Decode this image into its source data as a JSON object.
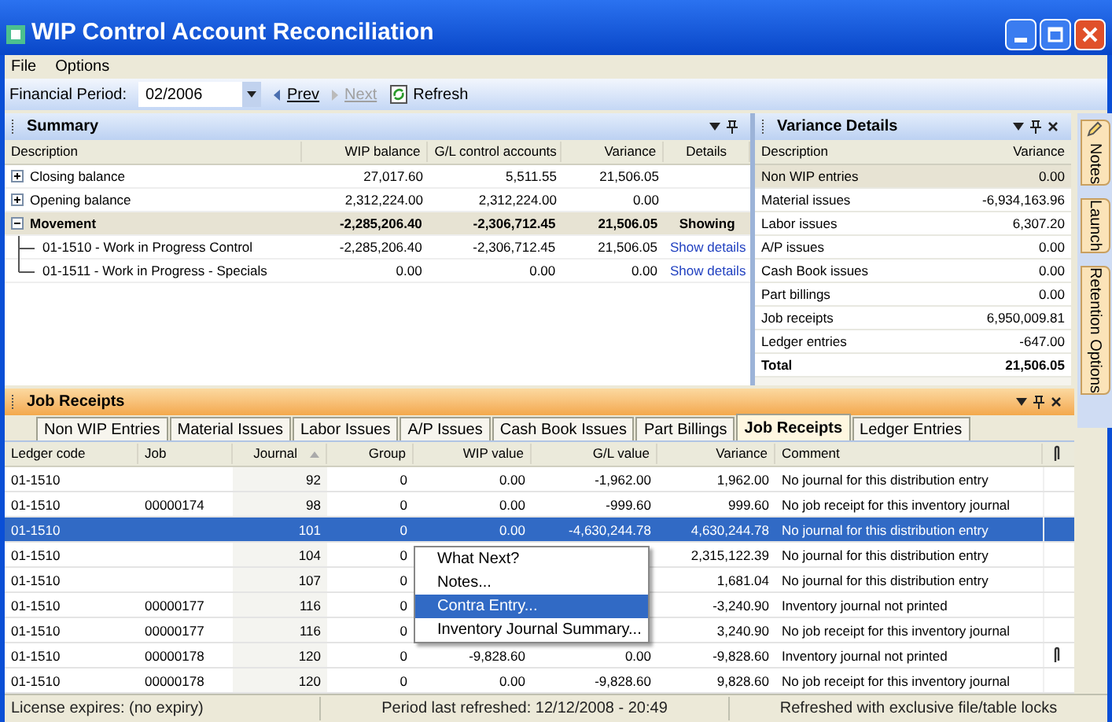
{
  "window": {
    "title": "WIP Control Account Reconciliation"
  },
  "menu": [
    "File",
    "Options"
  ],
  "toolbar": {
    "period_label": "Financial Period:",
    "period_value": "02/2006",
    "prev": {
      "label": "Prev",
      "disabled": false
    },
    "next": {
      "label": "Next",
      "disabled": true
    },
    "refresh": "Refresh"
  },
  "summary": {
    "title": "Summary",
    "columns": [
      "Description",
      "WIP balance",
      "G/L control accounts",
      "Variance",
      "Details"
    ],
    "rows": [
      {
        "kind": "group",
        "expanded": false,
        "cells": [
          "Closing balance",
          "27,017.60",
          "5,511.55",
          "21,506.05"
        ]
      },
      {
        "kind": "group",
        "expanded": false,
        "cells": [
          "Opening balance",
          "2,312,224.00",
          "2,312,224.00",
          "0.00"
        ]
      },
      {
        "kind": "group",
        "expanded": true,
        "cells": [
          "Movement",
          "-2,285,206.40",
          "-2,306,712.45",
          "21,506.05",
          "Showing"
        ]
      },
      {
        "kind": "child",
        "cells": [
          "01-1510 - Work in Progress Control",
          "-2,285,206.40",
          "-2,306,712.45",
          "21,506.05",
          "Show details"
        ]
      },
      {
        "kind": "child",
        "cells": [
          "01-1511 - Work in Progress - Specials",
          "0.00",
          "0.00",
          "0.00",
          "Show details"
        ]
      }
    ]
  },
  "variance": {
    "title": "Variance Details",
    "columns": [
      "Description",
      "Variance"
    ],
    "rows": [
      {
        "kind": "item",
        "selected": true,
        "cells": [
          "Non WIP entries",
          "0.00"
        ]
      },
      {
        "kind": "item",
        "selected": false,
        "cells": [
          "Material issues",
          "-6,934,163.96"
        ]
      },
      {
        "kind": "item",
        "selected": false,
        "cells": [
          "Labor issues",
          "6,307.20"
        ]
      },
      {
        "kind": "item",
        "selected": false,
        "cells": [
          "A/P issues",
          "0.00"
        ]
      },
      {
        "kind": "item",
        "selected": false,
        "cells": [
          "Cash Book issues",
          "0.00"
        ]
      },
      {
        "kind": "item",
        "selected": false,
        "cells": [
          "Part billings",
          "0.00"
        ]
      },
      {
        "kind": "item",
        "selected": false,
        "cells": [
          "Job receipts",
          "6,950,009.81"
        ]
      },
      {
        "kind": "item",
        "selected": false,
        "cells": [
          "Ledger entries",
          "-647.00"
        ]
      },
      {
        "kind": "total",
        "selected": false,
        "cells": [
          "Total",
          "21,506.05"
        ]
      }
    ]
  },
  "side_tabs": [
    "Notes",
    "Launch",
    "Retention Options"
  ],
  "job_receipts": {
    "title": "Job Receipts",
    "tabs": [
      {
        "label": "Non WIP Entries",
        "selected": false
      },
      {
        "label": "Material Issues",
        "selected": false
      },
      {
        "label": "Labor Issues",
        "selected": false
      },
      {
        "label": "A/P Issues",
        "selected": false
      },
      {
        "label": "Cash Book Issues",
        "selected": false
      },
      {
        "label": "Part Billings",
        "selected": false
      },
      {
        "label": "Job Receipts",
        "selected": true
      },
      {
        "label": "Ledger Entries",
        "selected": false
      }
    ],
    "columns": [
      "Ledger code",
      "Job",
      "Journal",
      "Group",
      "WIP value",
      "G/L value",
      "Variance",
      "Comment"
    ],
    "rows": [
      {
        "selected": false,
        "attachment": false,
        "cells": [
          "01-1510",
          "",
          "92",
          "0",
          "0.00",
          "-1,962.00",
          "1,962.00",
          "No journal for this distribution entry"
        ]
      },
      {
        "selected": false,
        "attachment": false,
        "cells": [
          "01-1510",
          "00000174",
          "98",
          "0",
          "0.00",
          "-999.60",
          "999.60",
          "No job receipt for this inventory journal"
        ]
      },
      {
        "selected": true,
        "attachment": false,
        "cells": [
          "01-1510",
          "",
          "101",
          "0",
          "0.00",
          "-4,630,244.78",
          "4,630,244.78",
          "No journal for this distribution entry"
        ]
      },
      {
        "selected": false,
        "attachment": false,
        "cells": [
          "01-1510",
          "",
          "104",
          "0",
          "",
          "",
          "2,315,122.39",
          "No journal for this distribution entry"
        ]
      },
      {
        "selected": false,
        "attachment": false,
        "cells": [
          "01-1510",
          "",
          "107",
          "0",
          "",
          "",
          "1,681.04",
          "No journal for this distribution entry"
        ]
      },
      {
        "selected": false,
        "attachment": false,
        "cells": [
          "01-1510",
          "00000177",
          "116",
          "0",
          "",
          "",
          "-3,240.90",
          "Inventory journal not printed"
        ]
      },
      {
        "selected": false,
        "attachment": false,
        "cells": [
          "01-1510",
          "00000177",
          "116",
          "0",
          "",
          "",
          "3,240.90",
          "No job receipt for this inventory journal"
        ]
      },
      {
        "selected": false,
        "attachment": true,
        "cells": [
          "01-1510",
          "00000178",
          "120",
          "0",
          "-9,828.60",
          "0.00",
          "-9,828.60",
          "Inventory journal not printed"
        ]
      },
      {
        "selected": false,
        "attachment": false,
        "cells": [
          "01-1510",
          "00000178",
          "120",
          "0",
          "0.00",
          "-9,828.60",
          "9,828.60",
          "No job receipt for this inventory journal"
        ]
      }
    ]
  },
  "context_menu": [
    {
      "label": "What Next?",
      "selected": false
    },
    {
      "label": "Notes...",
      "selected": false
    },
    {
      "label": "Contra Entry...",
      "selected": true
    },
    {
      "label": "Inventory Journal Summary...",
      "selected": false
    }
  ],
  "status_bar": [
    "License expires: (no expiry)",
    "Period last refreshed: 12/12/2008 - 20:49",
    "Refreshed with exclusive file/table locks"
  ]
}
